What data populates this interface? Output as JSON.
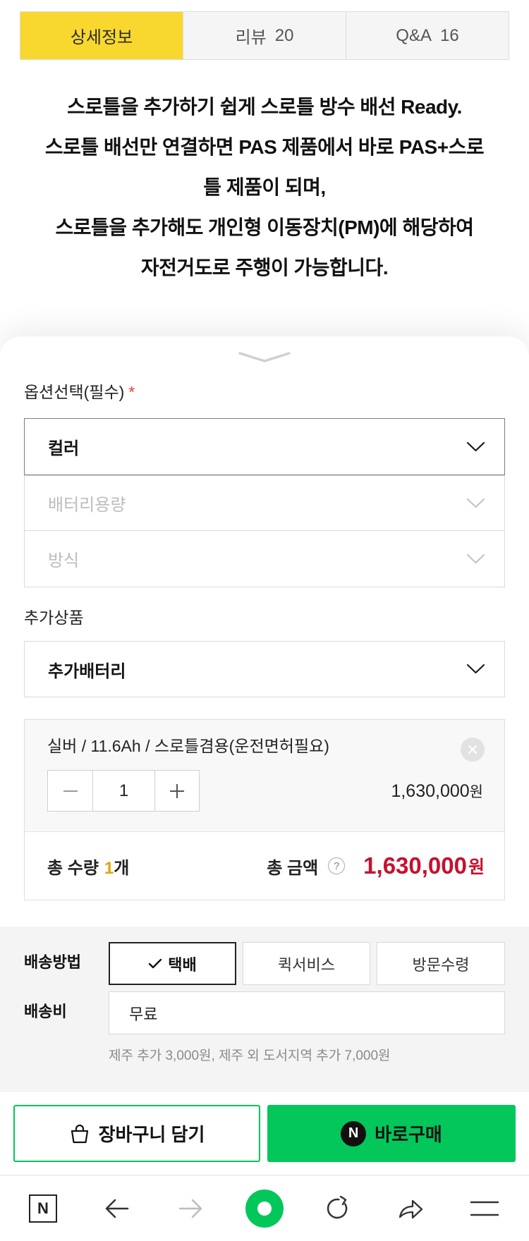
{
  "colors": {
    "tab_active": "#f8d82e",
    "naver_green": "#03c75a",
    "price_red": "#c8102e",
    "quantity_gold": "#e0a400",
    "required_red": "#e2412f"
  },
  "tabs": [
    {
      "label": "상세정보",
      "active": true
    },
    {
      "label": "리뷰",
      "count": "20",
      "active": false
    },
    {
      "label": "Q&A",
      "count": "16",
      "active": false
    }
  ],
  "description_lines": [
    "스로틀을 추가하기 쉽게 스로틀 방수 배선 Ready.",
    "스로틀 배선만 연결하면 PAS 제품에서 바로 PAS+스로",
    "틀 제품이 되며,",
    "스로틀을 추가해도 개인형 이동장치(PM)에 해당하여",
    "자전거도로 주행이 가능합니다."
  ],
  "sheet_handle_icon": "chevron-down-icon",
  "options": {
    "title": "옵션선택(필수)",
    "required_mark": "*",
    "selects": [
      {
        "label": "컬러",
        "enabled": true,
        "icon": "chevron-down-icon"
      },
      {
        "label": "배터리용량",
        "enabled": false,
        "icon": "chevron-down-icon"
      },
      {
        "label": "방식",
        "enabled": false,
        "icon": "chevron-down-icon"
      }
    ]
  },
  "addon": {
    "title": "추가상품",
    "select_label": "추가배터리",
    "icon": "chevron-down-icon"
  },
  "selected_item": {
    "name": "실버 / 11.6Ah / 스로틀겸용(운전면허필요)",
    "quantity": "1",
    "price": "1,630,000",
    "currency": "원",
    "remove_icon": "close-icon",
    "decrease_icon": "minus-icon",
    "increase_icon": "plus-icon"
  },
  "total": {
    "quantity_label": "총 수량",
    "quantity": "1",
    "quantity_unit": "개",
    "amount_label": "총 금액",
    "help": "?",
    "amount": "1,630,000",
    "currency": "원"
  },
  "delivery": {
    "method_label": "배송방법",
    "methods": [
      {
        "label": "택배",
        "selected": true,
        "icon": "check-icon"
      },
      {
        "label": "퀵서비스",
        "selected": false
      },
      {
        "label": "방문수령",
        "selected": false
      }
    ],
    "fee_label": "배송비",
    "fee_value": "무료",
    "note": "제주 추가 3,000원, 제주 외 도서지역 추가 7,000원"
  },
  "actions": {
    "cart_label": "장바구니 담기",
    "cart_icon": "shopping-bag-icon",
    "buy_label": "바로구매",
    "buy_logo": "N"
  },
  "browser_nav": {
    "logo": "N",
    "forward_enabled": false,
    "icons": [
      "naver-home-icon",
      "back-arrow-icon",
      "forward-arrow-icon",
      "green-dot-icon",
      "refresh-icon",
      "share-icon",
      "menu-icon"
    ]
  }
}
